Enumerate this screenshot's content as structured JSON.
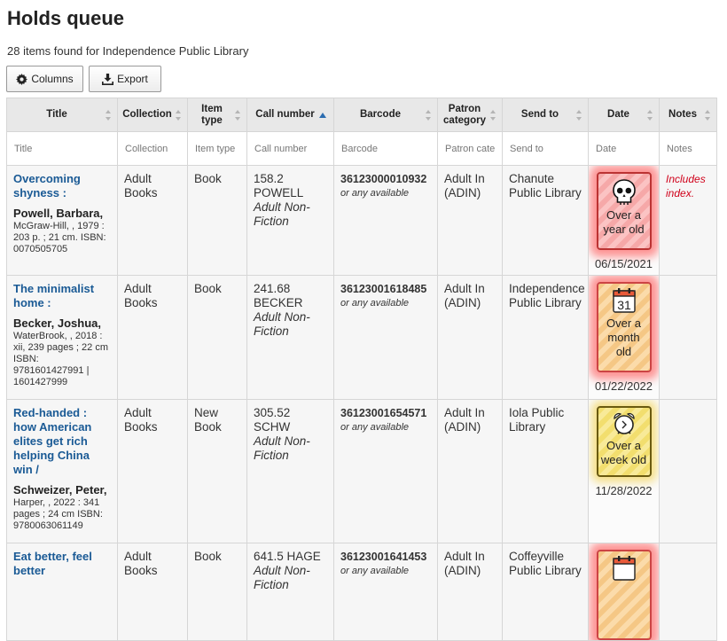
{
  "page": {
    "title": "Holds queue",
    "summary": "28 items found for Independence Public Library"
  },
  "toolbar": {
    "columns_label": "Columns",
    "export_label": "Export"
  },
  "table": {
    "headers": {
      "title": "Title",
      "collection": "Collection",
      "itemtype": "Item type",
      "callnumber": "Call number",
      "barcode": "Barcode",
      "patron": "Patron category",
      "sendto": "Send to",
      "date": "Date",
      "notes": "Notes"
    },
    "sorted_column": "callnumber",
    "filters": {
      "title": "Title",
      "collection": "Collection",
      "itemtype": "Item type",
      "callnumber": "Call number",
      "barcode": "Barcode",
      "patron": "Patron cate",
      "sendto": "Send to",
      "date": "Date",
      "notes": "Notes"
    },
    "rows": [
      {
        "title": "Overcoming shyness :",
        "author": "Powell, Barbara,",
        "pub": "McGraw-Hill, , 1979 : 203 p. ; 21 cm. ISBN: 0070505705",
        "collection": "Adult Books",
        "itemtype": "Book",
        "callnumber": "158.2 POWELL",
        "callnumber_loc": "Adult Non-Fiction",
        "barcode": "36123000010932",
        "barcode_note": "or any available",
        "patron": "Adult In (ADIN)",
        "sendto": "Chanute Public Library",
        "age_label": "Over a year old",
        "age_icon": "skull-icon",
        "date": "06/15/2021",
        "notes": "Includes index."
      },
      {
        "title": "The minimalist home :",
        "author": "Becker, Joshua,",
        "pub": "WaterBrook, , 2018 : xii, 239 pages ; 22 cm ISBN: 9781601427991 | 1601427999",
        "collection": "Adult Books",
        "itemtype": "Book",
        "callnumber": "241.68 BECKER",
        "callnumber_loc": "Adult Non-Fiction",
        "barcode": "36123001618485",
        "barcode_note": "or any available",
        "patron": "Adult In (ADIN)",
        "sendto": "Independence Public Library",
        "age_label": "Over a month old",
        "age_icon": "calendar-icon",
        "calendar_day": "31",
        "date": "01/22/2022",
        "notes": ""
      },
      {
        "title": "Red-handed : how American elites get rich helping China win /",
        "author": "Schweizer, Peter,",
        "pub": "Harper, , 2022 : 341 pages ; 24 cm ISBN: 9780063061149",
        "collection": "Adult Books",
        "itemtype": "New Book",
        "callnumber": "305.52 SCHW",
        "callnumber_loc": "Adult Non-Fiction",
        "barcode": "36123001654571",
        "barcode_note": "or any available",
        "patron": "Adult In (ADIN)",
        "sendto": "Iola Public Library",
        "age_label": "Over a week old",
        "age_icon": "alarm-clock-icon",
        "date": "11/28/2022",
        "notes": ""
      },
      {
        "title": "Eat better, feel better",
        "collection": "Adult Books",
        "itemtype": "Book",
        "callnumber": "641.5 HAGE",
        "callnumber_loc": "Adult Non-Fiction",
        "barcode": "36123001641453",
        "barcode_note": "or any available",
        "patron": "Adult In (ADIN)",
        "sendto": "Coffeyville Public Library",
        "age_icon": "calendar-icon"
      }
    ]
  },
  "colors": {
    "link": "#1a5a95",
    "note": "#d0021b",
    "header_bg": "#e8e8e8",
    "sort_active": "#2b6cb0"
  }
}
